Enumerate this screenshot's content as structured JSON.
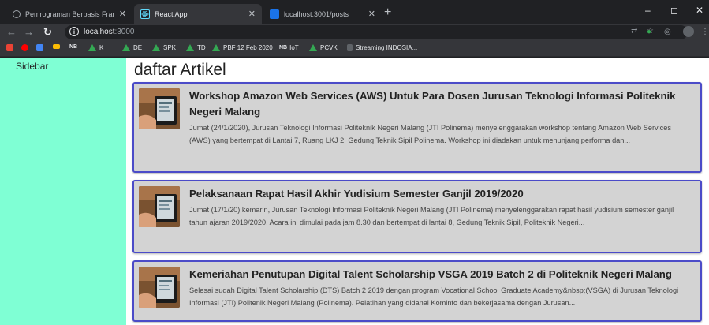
{
  "tabs": [
    {
      "title": "Pemrograman Berbasis Framewo",
      "favicon": "globe-icon",
      "active": false
    },
    {
      "title": "React App",
      "favicon": "react-icon",
      "active": true
    },
    {
      "title": "localhost:3001/posts",
      "favicon": "page-icon",
      "active": false
    }
  ],
  "window_controls": {
    "minimize": "–",
    "maximize": "◻",
    "close": "✕"
  },
  "toolbar": {
    "url_host": "localhost",
    "url_port": ":3000"
  },
  "bookmarks": [
    {
      "label": "",
      "icon": "gmail-icon",
      "color": "#ea4335"
    },
    {
      "label": "",
      "icon": "youtube-icon",
      "color": "#ff0000"
    },
    {
      "label": "",
      "icon": "maps-icon",
      "color": "#4285f4"
    },
    {
      "label": "",
      "icon": "bookmark-icon",
      "color": "#fbbc04"
    },
    {
      "label": "",
      "icon": "nb-icon",
      "color": "#e8eaed"
    },
    {
      "label": "K",
      "icon": "drive-icon",
      "color": "#34a853"
    },
    {
      "label": "DE",
      "icon": "drive-icon",
      "color": "#34a853"
    },
    {
      "label": "SPK",
      "icon": "drive-icon",
      "color": "#34a853"
    },
    {
      "label": "TD",
      "icon": "drive-icon",
      "color": "#34a853"
    },
    {
      "label": "PBF 12 Feb 2020",
      "icon": "drive-icon",
      "color": "#34a853"
    },
    {
      "label": "IoT",
      "icon": "nb-icon",
      "color": "#e8eaed"
    },
    {
      "label": "PCVK",
      "icon": "drive-icon",
      "color": "#34a853"
    },
    {
      "label": "Streaming INDOSIA...",
      "icon": "page-icon",
      "color": "#9aa0a6"
    }
  ],
  "sidebar": {
    "label": "Sidebar"
  },
  "main": {
    "title": "daftar Artikel",
    "articles": [
      {
        "title": "Workshop Amazon Web Services (AWS) Untuk Para Dosen Jurusan Teknologi Informasi Politeknik Negeri Malang",
        "desc": "Jumat (24/1/2020), Jurusan Teknologi Informasi Politeknik Negeri Malang (JTI Polinema) menyelenggarakan workshop tentang Amazon Web Services (AWS) yang bertempat di Lantai 7, Ruang LKJ 2, Gedung Teknik Sipil Polinema. Workshop ini diadakan untuk menunjang performa dan..."
      },
      {
        "title": "Pelaksanaan Rapat Hasil Akhir Yudisium Semester Ganjil 2019/2020",
        "desc": "Jumat (17/1/20) kemarin, Jurusan Teknologi Informasi Politeknik Negeri Malang (JTI Polinema) menyelenggarakan rapat hasil yudisium semester ganjil tahun ajaran 2019/2020. Acara ini dimulai pada jam 8.30 dan bertempat di lantai 8, Gedung Teknik Sipil, Politeknik Negeri..."
      },
      {
        "title": "Kemeriahan Penutupan Digital Talent Scholarship VSGA 2019 Batch 2 di Politeknik Negeri Malang",
        "desc": "Selesai sudah Digital Talent Scholarship (DTS) Batch 2 2019 dengan program Vocational School Graduate Academy&nbsp;(VSGA) di Jurusan Teknologi Informasi (JTI) Politenik Negeri Malang (Polinema). Pelatihan yang didanai Kominfo dan bekerjasama dengan Jurusan..."
      }
    ]
  }
}
